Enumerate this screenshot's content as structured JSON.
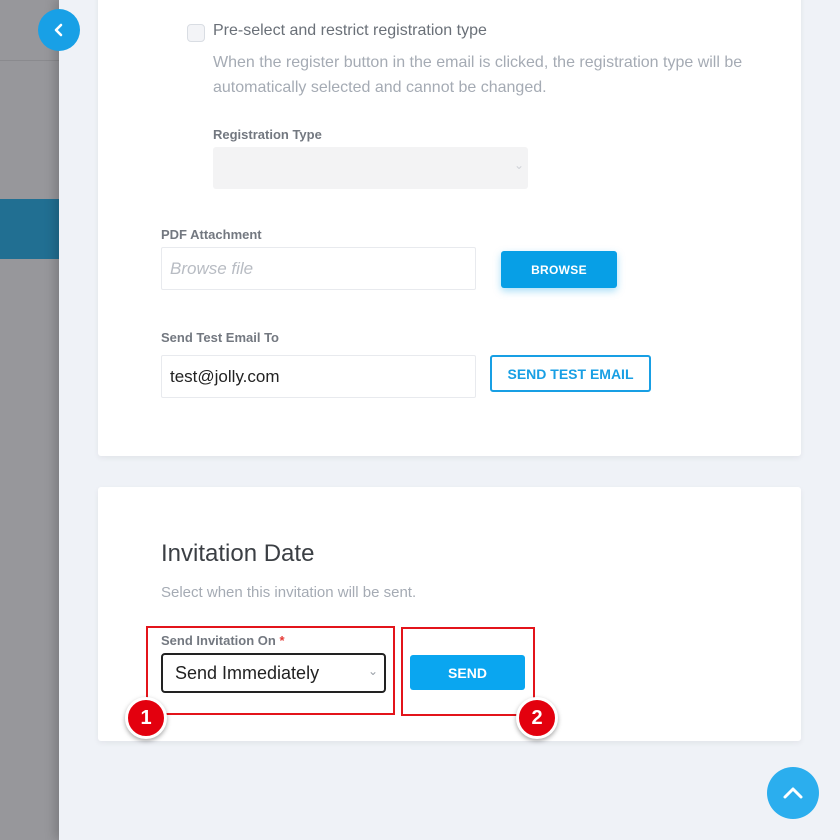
{
  "navigation": {
    "back_icon": "chevron-left-icon",
    "scroll_top_icon": "chevron-up-icon"
  },
  "registration": {
    "checkbox_label": "Pre-select and restrict registration type",
    "checkbox_checked": false,
    "checkbox_help": "When the register button in the email is clicked, the registration type will be automatically selected and cannot be changed.",
    "type_label": "Registration Type",
    "type_value": ""
  },
  "attachment": {
    "label": "PDF Attachment",
    "placeholder": "Browse file",
    "browse_label": "BROWSE"
  },
  "test_email": {
    "label": "Send Test Email To",
    "value": "test@jolly.com",
    "button_label": "SEND TEST EMAIL"
  },
  "invitation_date": {
    "title": "Invitation Date",
    "subtitle": "Select when this invitation will be sent.",
    "field_label": "Send Invitation On",
    "required_mark": "*",
    "selected_option": "Send Immediately",
    "send_label": "SEND"
  },
  "annotations": [
    {
      "number": "1",
      "target": "send-invitation-on-select"
    },
    {
      "number": "2",
      "target": "send-button"
    }
  ],
  "colors": {
    "primary": "#079fe6",
    "annotation": "#e3141b"
  }
}
